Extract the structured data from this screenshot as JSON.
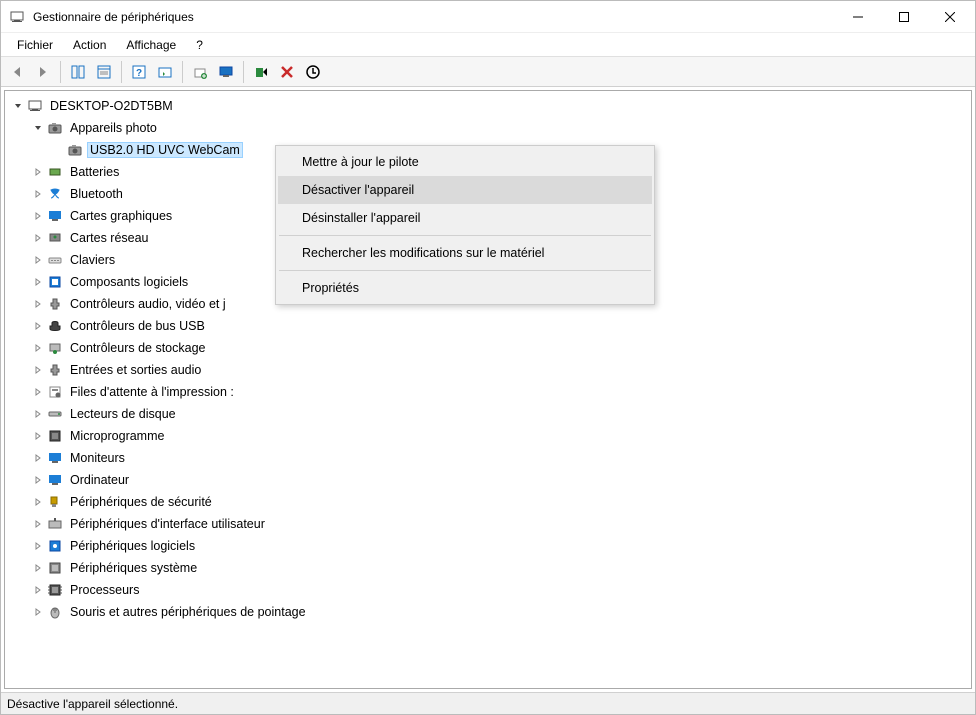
{
  "window": {
    "title": "Gestionnaire de périphériques"
  },
  "menubar": {
    "items": [
      "Fichier",
      "Action",
      "Affichage",
      "?"
    ]
  },
  "tree": {
    "root": "DESKTOP-O2DT5BM",
    "cameras": {
      "label": "Appareils photo",
      "device": "USB2.0 HD UVC WebCam"
    },
    "categories": [
      "Batteries",
      "Bluetooth",
      "Cartes graphiques",
      "Cartes réseau",
      "Claviers",
      "Composants logiciels",
      "Contrôleurs audio, vidéo et j",
      "Contrôleurs de bus USB",
      "Contrôleurs de stockage",
      "Entrées et sorties audio",
      "Files d'attente à l'impression :",
      "Lecteurs de disque",
      "Microprogramme",
      "Moniteurs",
      "Ordinateur",
      "Périphériques de sécurité",
      "Périphériques d'interface utilisateur",
      "Périphériques logiciels",
      "Périphériques système",
      "Processeurs",
      "Souris et autres périphériques de pointage"
    ]
  },
  "context_menu": {
    "items": [
      "Mettre à jour le pilote",
      "Désactiver l'appareil",
      "Désinstaller l'appareil",
      "Rechercher les modifications sur le matériel",
      "Propriétés"
    ]
  },
  "statusbar": {
    "text": "Désactive l'appareil sélectionné."
  }
}
